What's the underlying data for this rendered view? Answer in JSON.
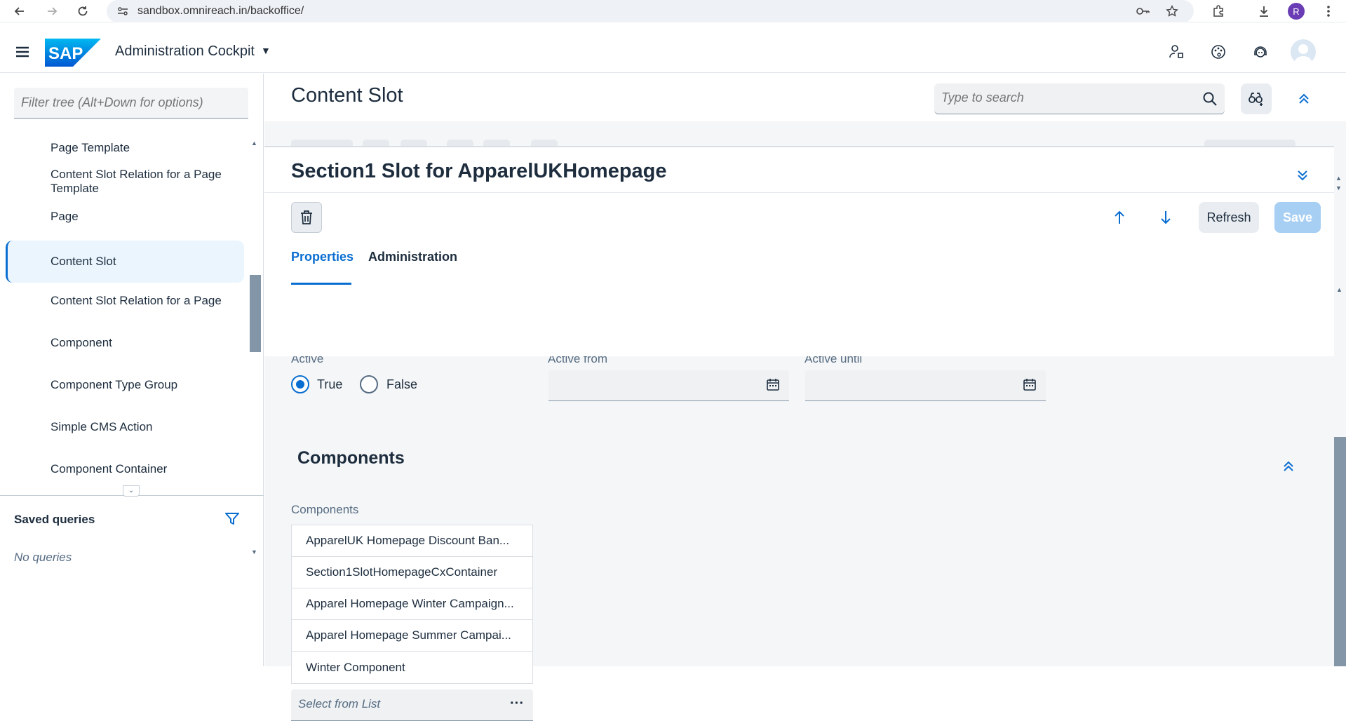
{
  "browser": {
    "url": "sandbox.omnireach.in/backoffice/",
    "profile_initial": "R"
  },
  "header": {
    "app_title": "Administration Cockpit",
    "logo_text": "SAP"
  },
  "sidebar": {
    "filter_placeholder": "Filter tree (Alt+Down for options)",
    "items": [
      {
        "label": "Page Template"
      },
      {
        "label": "Content Slot Relation for a Page Template"
      },
      {
        "label": "Page"
      },
      {
        "label": "Content Slot",
        "selected": true
      },
      {
        "label": "Content Slot Relation for a Page"
      },
      {
        "label": "Component"
      },
      {
        "label": "Component Type Group"
      },
      {
        "label": "Simple CMS Action"
      },
      {
        "label": "Component Container"
      }
    ],
    "saved_queries_title": "Saved queries",
    "no_queries": "No queries"
  },
  "main": {
    "title": "Content Slot",
    "search_placeholder": "Type to search"
  },
  "detail": {
    "title": "Section1 Slot for ApparelUKHomepage",
    "refresh_label": "Refresh",
    "save_label": "Save",
    "tabs": [
      {
        "label": "Properties",
        "active": true
      },
      {
        "label": "Administration"
      }
    ],
    "fields": {
      "active_label": "Active",
      "active_from_label": "Active from",
      "active_until_label": "Active until",
      "radio_true": "True",
      "radio_false": "False",
      "active_value": "True"
    },
    "components_section": {
      "title": "Components",
      "field_label": "Components",
      "items": [
        "ApparelUK Homepage Discount Ban...",
        "Section1SlotHomepageCxContainer",
        "Apparel Homepage Winter Campaign...",
        "Apparel Homepage Summer Campai...",
        "Winter Component"
      ],
      "select_placeholder": "Select from List"
    }
  },
  "colors": {
    "accent": "#0a6ed1",
    "selected_bg": "#eaf5fe",
    "save_disabled": "#a7cff3"
  }
}
